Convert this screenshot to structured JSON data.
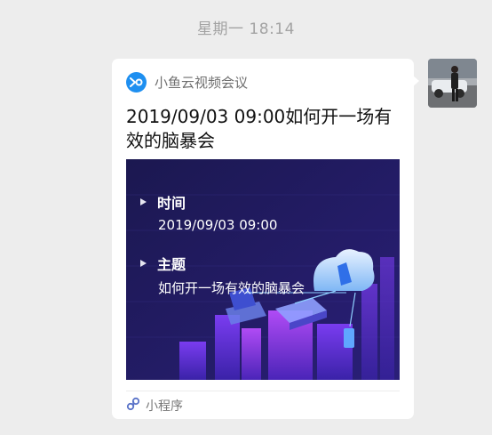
{
  "timestamp": "星期一 18:14",
  "message_card": {
    "app": {
      "name": "小鱼云视频会议",
      "logo_icon": "xiaoyu-logo-icon",
      "brand_color": "#1e8ff0"
    },
    "title": "2019/09/03 09:00如何开一场有效的脑暴会",
    "banner": {
      "background_color": "#1e1a5a",
      "time_label": "时间",
      "time_value": "2019/09/03 09:00",
      "topic_label": "主题",
      "topic_value": "如何开一场有效的脑暴会"
    },
    "footer": {
      "icon": "mini-program-icon",
      "label": "小程序"
    }
  },
  "sender": {
    "avatar_icon": "avatar"
  }
}
